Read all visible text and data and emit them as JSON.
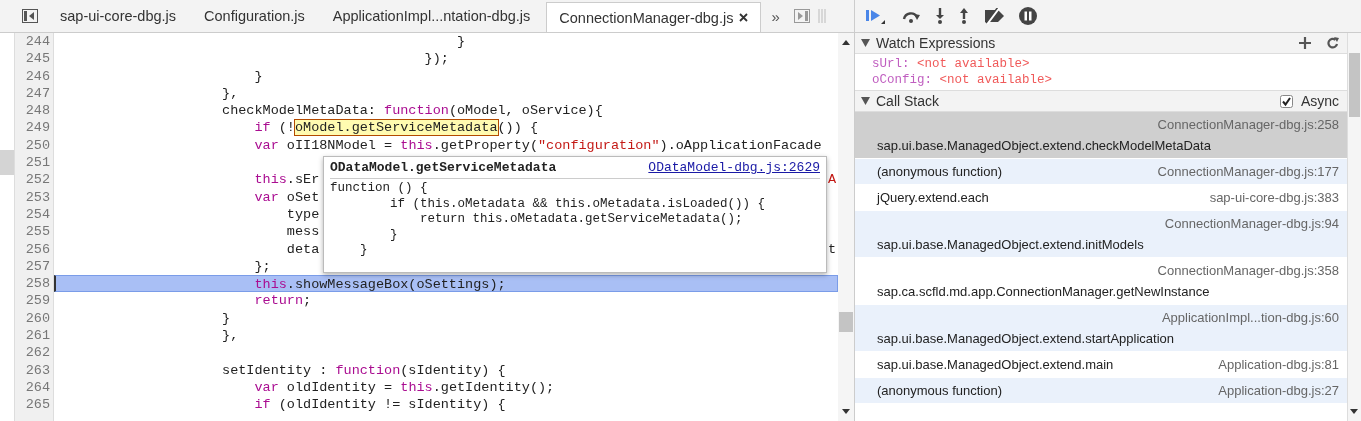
{
  "tabs": [
    {
      "label": "sap-ui-core-dbg.js",
      "selected": false
    },
    {
      "label": "Configuration.js",
      "selected": false
    },
    {
      "label": "ApplicationImpl...ntation-dbg.js",
      "selected": false
    },
    {
      "label": "ConnectionManager-dbg.js",
      "selected": true,
      "closable": true
    }
  ],
  "tabs_overflow": "»",
  "editor": {
    "lines": [
      {
        "number": "244",
        "current": false,
        "code": [
          {
            "kind": "plain",
            "text": "                                                 }"
          }
        ]
      },
      {
        "number": "245",
        "current": false,
        "code": [
          {
            "kind": "plain",
            "text": "                                             });"
          }
        ]
      },
      {
        "number": "246",
        "current": false,
        "code": [
          {
            "kind": "plain",
            "text": "                        }"
          }
        ]
      },
      {
        "number": "247",
        "current": false,
        "code": [
          {
            "kind": "plain",
            "text": "                    },"
          }
        ]
      },
      {
        "number": "248",
        "current": false,
        "code": [
          {
            "kind": "plain",
            "text": "                    checkModelMetaData: "
          },
          {
            "kind": "keyword",
            "text": "function"
          },
          {
            "kind": "plain",
            "text": "(oModel, oService){"
          }
        ]
      },
      {
        "number": "249",
        "current": false,
        "code": [
          {
            "kind": "keyword",
            "text": "                        if"
          },
          {
            "kind": "plain",
            "text": " (!"
          },
          {
            "kind": "hover",
            "text": "oModel.getServiceMetadata"
          },
          {
            "kind": "plain",
            "text": "()) {"
          }
        ]
      },
      {
        "number": "250",
        "current": false,
        "code": [
          {
            "kind": "keyword",
            "text": "                        var"
          },
          {
            "kind": "plain",
            "text": " oII18NModel = "
          },
          {
            "kind": "keyword",
            "text": "this"
          },
          {
            "kind": "plain",
            "text": ".getProperty("
          },
          {
            "kind": "string",
            "text": "\"configuration\""
          },
          {
            "kind": "plain",
            "text": ").oApplicationFacade"
          }
        ]
      },
      {
        "number": "251",
        "current": false
      },
      {
        "number": "252",
        "current": false,
        "code": [
          {
            "kind": "keyword",
            "text": "                        this"
          },
          {
            "kind": "plain",
            "text": ".sEr"
          }
        ],
        "tail": {
          "kind": "string",
          "text": "A"
        }
      },
      {
        "number": "253",
        "current": false,
        "code": [
          {
            "kind": "keyword",
            "text": "                        var"
          },
          {
            "kind": "plain",
            "text": " oSet"
          }
        ]
      },
      {
        "number": "254",
        "current": false,
        "code": [
          {
            "kind": "plain",
            "text": "                            type"
          }
        ]
      },
      {
        "number": "255",
        "current": false,
        "code": [
          {
            "kind": "plain",
            "text": "                            mess"
          }
        ]
      },
      {
        "number": "256",
        "current": false,
        "code": [
          {
            "kind": "plain",
            "text": "                            deta"
          }
        ],
        "tail": {
          "kind": "plain",
          "text": "t"
        }
      },
      {
        "number": "257",
        "current": false,
        "code": [
          {
            "kind": "plain",
            "text": "                        };"
          }
        ]
      },
      {
        "number": "258",
        "current": true,
        "code": [
          {
            "kind": "keyword",
            "text": "                        this"
          },
          {
            "kind": "plain",
            "text": ".showMessageBox(oSettings);"
          }
        ]
      },
      {
        "number": "259",
        "current": false,
        "code": [
          {
            "kind": "keyword",
            "text": "                        return"
          },
          {
            "kind": "plain",
            "text": ";"
          }
        ]
      },
      {
        "number": "260",
        "current": false,
        "code": [
          {
            "kind": "plain",
            "text": "                    }"
          }
        ]
      },
      {
        "number": "261",
        "current": false,
        "code": [
          {
            "kind": "plain",
            "text": "                    },"
          }
        ]
      },
      {
        "number": "262",
        "current": false
      },
      {
        "number": "263",
        "current": false,
        "code": [
          {
            "kind": "plain",
            "text": "                    setIdentity : "
          },
          {
            "kind": "keyword",
            "text": "function"
          },
          {
            "kind": "plain",
            "text": "(sIdentity) {"
          }
        ]
      },
      {
        "number": "264",
        "current": false,
        "code": [
          {
            "kind": "keyword",
            "text": "                        var"
          },
          {
            "kind": "plain",
            "text": " oldIdentity = "
          },
          {
            "kind": "keyword",
            "text": "this"
          },
          {
            "kind": "plain",
            "text": ".getIdentity();"
          }
        ]
      },
      {
        "number": "265",
        "current": false,
        "code": [
          {
            "kind": "keyword",
            "text": "                        if"
          },
          {
            "kind": "plain",
            "text": " (oldIdentity != sIdentity) {"
          }
        ]
      }
    ]
  },
  "popover": {
    "title": "ODataModel.getServiceMetadata",
    "link": "ODataModel-dbg.js:2629",
    "code": [
      "function () {",
      "        if (this.oMetadata && this.oMetadata.isLoaded()) {",
      "            return this.oMetadata.getServiceMetadata();",
      "        }",
      "    }"
    ]
  },
  "watch": {
    "title": "Watch Expressions",
    "expanded": true,
    "items": [
      {
        "name": "sUrl:",
        "value": "<not available>"
      },
      {
        "name": "oConfig:",
        "value": "<not available>"
      }
    ]
  },
  "call_stack": {
    "title": "Call Stack",
    "expanded": true,
    "async_label": "Async",
    "async_checked": true,
    "frames": [
      {
        "kind": "stacked",
        "name": "sap.ui.base.ManagedObject.extend.checkModelMetaData",
        "location": "ConnectionManager-dbg.js:258",
        "selected": true
      },
      {
        "kind": "inline",
        "name": "(anonymous function)",
        "location": "ConnectionManager-dbg.js:177",
        "selected": false
      },
      {
        "kind": "inline",
        "name": "jQuery.extend.each",
        "location": "sap-ui-core-dbg.js:383",
        "selected": false
      },
      {
        "kind": "stacked",
        "name": "sap.ui.base.ManagedObject.extend.initModels",
        "location": "ConnectionManager-dbg.js:94",
        "selected": false
      },
      {
        "kind": "stacked",
        "name": "sap.ca.scfld.md.app.ConnectionManager.getNewInstance",
        "location": "ConnectionManager-dbg.js:358",
        "selected": false
      },
      {
        "kind": "stacked",
        "name": "sap.ui.base.ManagedObject.extend.startApplication",
        "location": "ApplicationImpl...tion-dbg.js:60",
        "selected": false
      },
      {
        "kind": "inline",
        "name": "sap.ui.base.ManagedObject.extend.main",
        "location": "Application-dbg.js:81",
        "selected": false
      },
      {
        "kind": "inline",
        "name": "(anonymous function)",
        "location": "Application-dbg.js:27",
        "selected": false
      }
    ]
  }
}
